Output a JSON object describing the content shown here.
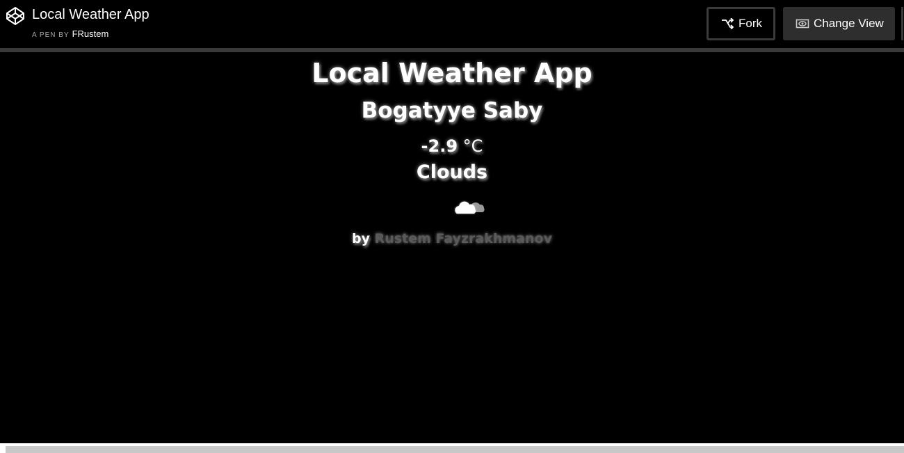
{
  "header": {
    "title": "Local Weather App",
    "by_prefix": "A PEN BY",
    "author": "FRustem",
    "fork_label": "Fork",
    "change_view_label": "Change View"
  },
  "weather": {
    "app_title": "Local Weather App",
    "city": "Bogatyye Saby",
    "temperature": "-2.9",
    "unit": "°C",
    "condition": "Clouds",
    "icon": "cloud-icon",
    "credit_prefix": "by",
    "credit_name": "Rustem Fayzrakhmanov"
  },
  "colors": {
    "background": "#000000",
    "text": "#ffffff",
    "button_dark": "#2e2e2e",
    "author_link": "#5a5a5a"
  }
}
